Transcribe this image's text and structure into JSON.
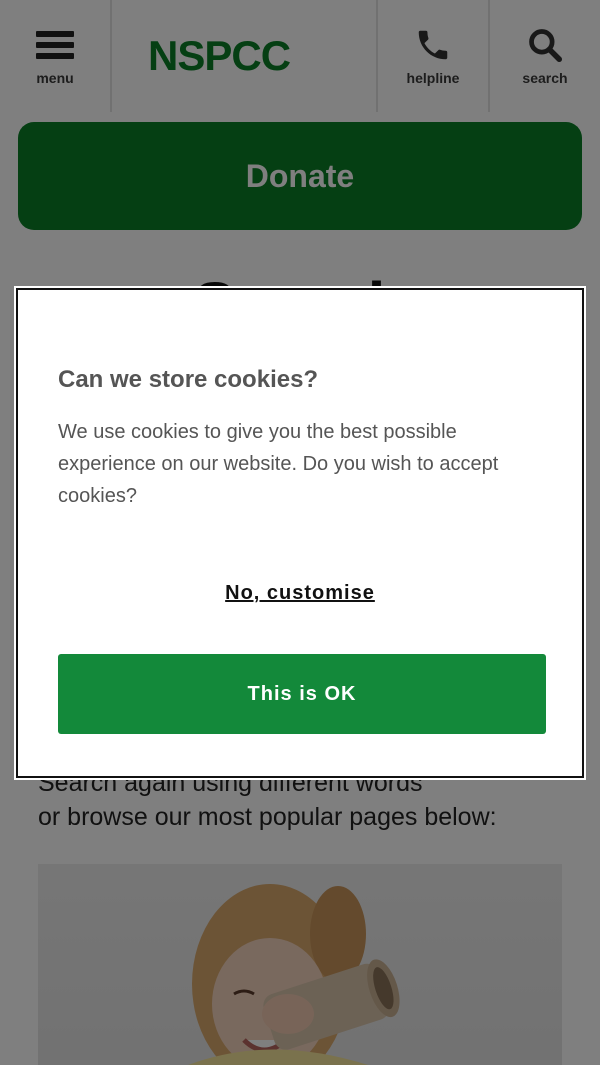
{
  "header": {
    "menu_label": "menu",
    "logo_text": "NSPCC",
    "helpline_label": "helpline",
    "search_label": "search",
    "brand_color": "#0a7e26"
  },
  "donate": {
    "label": "Donate"
  },
  "main": {
    "heading": "Search",
    "intro_line1": "Search again using different words",
    "intro_line2": "or browse our most popular pages below:"
  },
  "cookie_dialog": {
    "title": "Can we store cookies?",
    "body": "We use cookies to give you the best possible experience on our website. Do you wish to accept cookies?",
    "customise_label": "No, customise",
    "accept_label": "This is OK",
    "accept_color": "#13893a"
  },
  "icons": [
    "hamburger-menu-icon",
    "phone-icon",
    "search-icon"
  ]
}
